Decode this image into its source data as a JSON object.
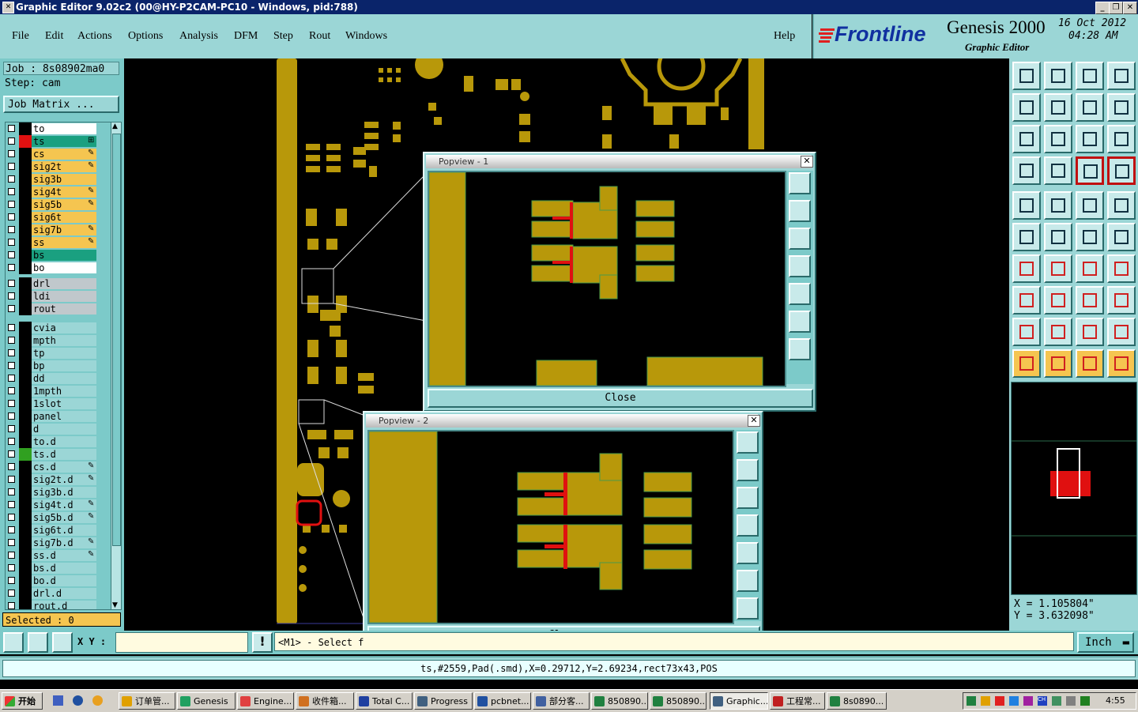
{
  "window": {
    "title": "Graphic Editor 9.02c2 (00@HY-P2CAM-PC10 - Windows, pid:788)"
  },
  "menu": {
    "file": "File",
    "edit": "Edit",
    "actions": "Actions",
    "options": "Options",
    "analysis": "Analysis",
    "dfm": "DFM",
    "step": "Step",
    "rout": "Rout",
    "windows": "Windows",
    "help": "Help"
  },
  "brand": {
    "logo": "Frontline",
    "product": "Genesis 2000",
    "subtitle": "Graphic Editor",
    "date": "16 Oct 2012",
    "time": "04:28 AM"
  },
  "job": {
    "job_label": "Job : 8s08902ma0",
    "step_label": "Step: cam",
    "matrix_button": "Job Matrix ..."
  },
  "layers_group1": [
    {
      "name": "to",
      "color": "#ffffff",
      "swatch": "#000000",
      "pen": ""
    },
    {
      "name": "ts",
      "color": "#1aa080",
      "swatch": "#e01010",
      "pen": "⊞"
    },
    {
      "name": "cs",
      "color": "#f5c550",
      "swatch": "#000000",
      "pen": "✎"
    },
    {
      "name": "sig2t",
      "color": "#f5c550",
      "swatch": "#000000",
      "pen": "✎"
    },
    {
      "name": "sig3b",
      "color": "#f5c550",
      "swatch": "#000000",
      "pen": ""
    },
    {
      "name": "sig4t",
      "color": "#f5c550",
      "swatch": "#000000",
      "pen": "✎"
    },
    {
      "name": "sig5b",
      "color": "#f5c550",
      "swatch": "#000000",
      "pen": "✎"
    },
    {
      "name": "sig6t",
      "color": "#f5c550",
      "swatch": "#000000",
      "pen": ""
    },
    {
      "name": "sig7b",
      "color": "#f5c550",
      "swatch": "#000000",
      "pen": "✎"
    },
    {
      "name": "ss",
      "color": "#f5c550",
      "swatch": "#000000",
      "pen": "✎"
    },
    {
      "name": "bs",
      "color": "#1aa080",
      "swatch": "#000000",
      "pen": ""
    },
    {
      "name": "bo",
      "color": "#ffffff",
      "swatch": "#000000",
      "pen": ""
    }
  ],
  "layers_group2": [
    {
      "name": "drl",
      "color": "#c0c8cc",
      "swatch": "#000000",
      "pen": ""
    },
    {
      "name": "ldi",
      "color": "#c0c8cc",
      "swatch": "#000000",
      "pen": ""
    },
    {
      "name": "rout",
      "color": "#c0c8cc",
      "swatch": "#000000",
      "pen": ""
    }
  ],
  "layers_group3": [
    {
      "name": "cvia",
      "color": "#9bd6d6",
      "swatch": "#000000",
      "pen": ""
    },
    {
      "name": "mpth",
      "color": "#9bd6d6",
      "swatch": "#000000",
      "pen": ""
    },
    {
      "name": "tp",
      "color": "#9bd6d6",
      "swatch": "#000000",
      "pen": ""
    },
    {
      "name": "bp",
      "color": "#9bd6d6",
      "swatch": "#000000",
      "pen": ""
    },
    {
      "name": "dd",
      "color": "#9bd6d6",
      "swatch": "#000000",
      "pen": ""
    },
    {
      "name": "1mpth",
      "color": "#9bd6d6",
      "swatch": "#000000",
      "pen": ""
    },
    {
      "name": "1slot",
      "color": "#9bd6d6",
      "swatch": "#000000",
      "pen": ""
    },
    {
      "name": "panel",
      "color": "#9bd6d6",
      "swatch": "#000000",
      "pen": ""
    },
    {
      "name": "d",
      "color": "#9bd6d6",
      "swatch": "#000000",
      "pen": ""
    },
    {
      "name": "to.d",
      "color": "#9bd6d6",
      "swatch": "#000000",
      "pen": ""
    },
    {
      "name": "ts.d",
      "color": "#9bd6d6",
      "swatch": "#30a020",
      "pen": ""
    },
    {
      "name": "cs.d",
      "color": "#9bd6d6",
      "swatch": "#000000",
      "pen": "✎"
    },
    {
      "name": "sig2t.d",
      "color": "#9bd6d6",
      "swatch": "#000000",
      "pen": "✎"
    },
    {
      "name": "sig3b.d",
      "color": "#9bd6d6",
      "swatch": "#000000",
      "pen": ""
    },
    {
      "name": "sig4t.d",
      "color": "#9bd6d6",
      "swatch": "#000000",
      "pen": "✎"
    },
    {
      "name": "sig5b.d",
      "color": "#9bd6d6",
      "swatch": "#000000",
      "pen": "✎"
    },
    {
      "name": "sig6t.d",
      "color": "#9bd6d6",
      "swatch": "#000000",
      "pen": ""
    },
    {
      "name": "sig7b.d",
      "color": "#9bd6d6",
      "swatch": "#000000",
      "pen": "✎"
    },
    {
      "name": "ss.d",
      "color": "#9bd6d6",
      "swatch": "#000000",
      "pen": "✎"
    },
    {
      "name": "bs.d",
      "color": "#9bd6d6",
      "swatch": "#000000",
      "pen": ""
    },
    {
      "name": "bo.d",
      "color": "#9bd6d6",
      "swatch": "#000000",
      "pen": ""
    },
    {
      "name": "drl.d",
      "color": "#9bd6d6",
      "swatch": "#000000",
      "pen": ""
    },
    {
      "name": "rout.d",
      "color": "#9bd6d6",
      "swatch": "#000000",
      "pen": ""
    }
  ],
  "selected": "Selected : 0",
  "popview1": {
    "title": "Popview - 1",
    "close": "Close"
  },
  "popview2": {
    "title": "Popview - 2",
    "close": "Close"
  },
  "coords": {
    "x": "X = 1.105804\"",
    "y": "Y = 3.632098\""
  },
  "bottom": {
    "xy_label": "X Y :",
    "xy_value": "",
    "message": "<M1> - Select f",
    "units": "Inch"
  },
  "status": "ts,#2559,Pad(.smd),X=0.29712,Y=2.69234,rect73x43,POS",
  "taskbar": {
    "start": "开始",
    "tasks": [
      "订单管...",
      "Genesis",
      "Engine...",
      "收件箱...",
      "Total C...",
      "Progress",
      "pcbnet...",
      "部分客...",
      "850890...",
      "850890...",
      "Graphic...",
      "工程常...",
      "8s0890..."
    ],
    "clock": "4:55"
  },
  "colors": {
    "copper": "#b8980a",
    "highlight": "#e01010",
    "panel": "#9bd6d6"
  }
}
